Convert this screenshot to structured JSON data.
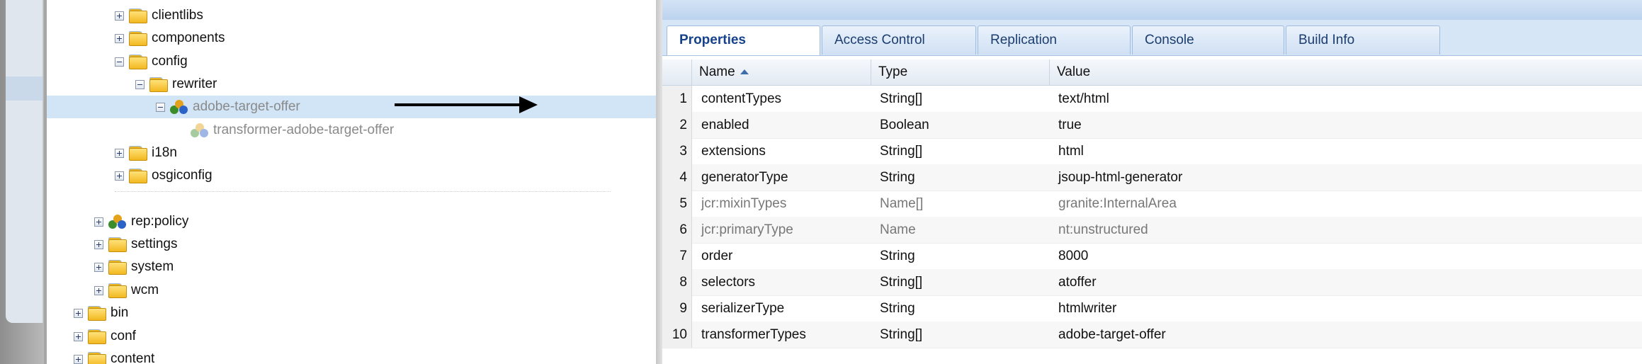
{
  "tree": {
    "nodes": [
      {
        "label": "clientlibs",
        "type": "folder",
        "toggle": "plus"
      },
      {
        "label": "components",
        "type": "folder",
        "toggle": "plus"
      },
      {
        "label": "config",
        "type": "folder",
        "toggle": "minus"
      },
      {
        "label": "rewriter",
        "type": "folder",
        "toggle": "minus"
      },
      {
        "label": "adobe-target-offer",
        "type": "node",
        "toggle": "minus",
        "selected": true
      },
      {
        "label": "transformer-adobe-target-offer",
        "type": "node",
        "toggle": "none"
      },
      {
        "label": "i18n",
        "type": "folder",
        "toggle": "plus"
      },
      {
        "label": "osgiconfig",
        "type": "folder",
        "toggle": "plus"
      },
      {
        "label": "rep:policy",
        "type": "node",
        "toggle": "plus"
      },
      {
        "label": "settings",
        "type": "folder",
        "toggle": "plus"
      },
      {
        "label": "system",
        "type": "folder",
        "toggle": "plus"
      },
      {
        "label": "wcm",
        "type": "folder",
        "toggle": "plus"
      },
      {
        "label": "bin",
        "type": "folder",
        "toggle": "plus"
      },
      {
        "label": "conf",
        "type": "folder",
        "toggle": "plus"
      },
      {
        "label": "content",
        "type": "folder",
        "toggle": "plus"
      }
    ]
  },
  "tabs": [
    "Properties",
    "Access Control",
    "Replication",
    "Console",
    "Build Info"
  ],
  "active_tab": "Properties",
  "grid": {
    "columns": [
      "Name",
      "Type",
      "Value"
    ],
    "rows": [
      {
        "num": "1",
        "name": "contentTypes",
        "type": "String[]",
        "value": "text/html"
      },
      {
        "num": "2",
        "name": "enabled",
        "type": "Boolean",
        "value": "true"
      },
      {
        "num": "3",
        "name": "extensions",
        "type": "String[]",
        "value": "html"
      },
      {
        "num": "4",
        "name": "generatorType",
        "type": "String",
        "value": "jsoup-html-generator"
      },
      {
        "num": "5",
        "name": "jcr:mixinTypes",
        "type": "Name[]",
        "value": "granite:InternalArea"
      },
      {
        "num": "6",
        "name": "jcr:primaryType",
        "type": "Name",
        "value": "nt:unstructured"
      },
      {
        "num": "7",
        "name": "order",
        "type": "String",
        "value": "8000"
      },
      {
        "num": "8",
        "name": "selectors",
        "type": "String[]",
        "value": "atoffer"
      },
      {
        "num": "9",
        "name": "serializerType",
        "type": "String",
        "value": "htmlwriter"
      },
      {
        "num": "10",
        "name": "transformerTypes",
        "type": "String[]",
        "value": "adobe-target-offer"
      }
    ]
  },
  "colors": {
    "selection": "#d1e5f7",
    "tab_text": "#15428b",
    "header_blue": "#bcd3ee"
  }
}
